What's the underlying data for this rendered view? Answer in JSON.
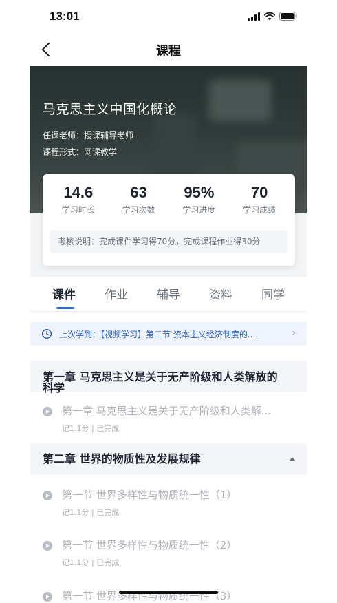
{
  "status_bar": {
    "time": "13:01"
  },
  "nav": {
    "title": "课程"
  },
  "course": {
    "title": "马克思主义中国化概论",
    "teacher_line": "任课老师：授课辅导老师",
    "format_line": "课程形式：网课教学"
  },
  "stats": [
    {
      "value": "14.6",
      "label": "学习时长"
    },
    {
      "value": "63",
      "label": "学习次数"
    },
    {
      "value": "95%",
      "label": "学习进度"
    },
    {
      "value": "70",
      "label": "学习成绩"
    }
  ],
  "exam_note": "考核说明：完成课件学习得70分，完成课程作业得30分",
  "tabs": [
    {
      "label": "课件",
      "active": true
    },
    {
      "label": "作业",
      "active": false
    },
    {
      "label": "辅导",
      "active": false
    },
    {
      "label": "资料",
      "active": false
    },
    {
      "label": "同学",
      "active": false
    }
  ],
  "last_studied": {
    "text": "上次学到：【视频学习】第二节 资本主义经济制度的...",
    "arrow": "›"
  },
  "chapters": [
    {
      "title_line1": "第一章 马克思主义是关于无产阶级和人类解放的",
      "title_line2": "科学",
      "lessons": [
        {
          "title": "第一章 马克思主义是关于无产阶级和人类解...",
          "meta": "记1.1分 | 已完成"
        }
      ]
    },
    {
      "title_line1": "第二章 世界的物质性及发展规律",
      "lessons": [
        {
          "title": "第一节 世界多样性与物质统一性（1）",
          "meta": "记1.1分 | 已完成"
        },
        {
          "title": "第一节 世界多样性与物质统一性（2）",
          "meta": "记1.1分 | 已完成"
        },
        {
          "title": "第一节 世界多样性与物质统一性（3）",
          "meta": ""
        }
      ]
    }
  ],
  "colors": {
    "accent": "#2b6fe8",
    "last_studied_bg": "#eef3fd",
    "chapter_bg": "#f4f5f8"
  }
}
